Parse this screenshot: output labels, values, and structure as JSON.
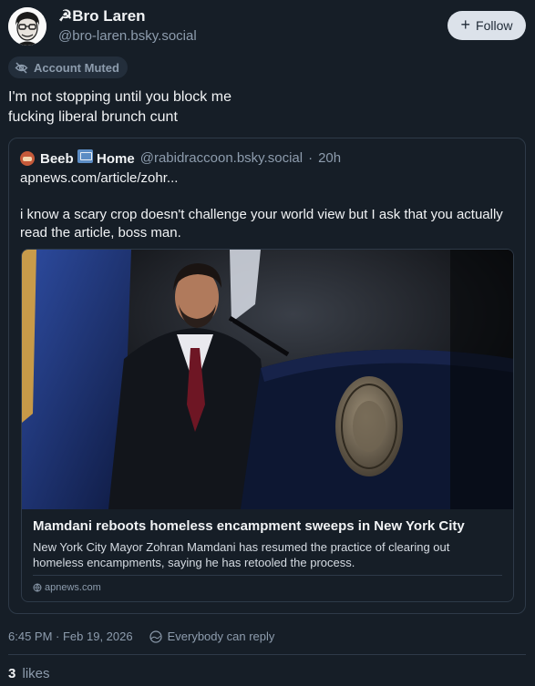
{
  "author": {
    "name": "☭Bro Laren",
    "handle": "@bro-laren.bsky.social"
  },
  "follow_button": {
    "label": "Follow"
  },
  "muted_badge": {
    "label": "Account Muted"
  },
  "post": {
    "line1": "I'm not stopping until you block me",
    "line2": "fucking liberal brunch cunt"
  },
  "quote": {
    "author_name_part1": "Beeb",
    "author_name_part2": "Home",
    "handle": "@rabidraccoon.bsky.social",
    "separator": "·",
    "time": "20h",
    "link_text": "apnews.com/article/zohr...",
    "body": "i know a scary crop doesn't challenge your world view but I ask that you actually read the article, boss man."
  },
  "link_card": {
    "title": "Mamdani reboots homeless encampment sweeps in New York City",
    "description": "New York City Mayor Zohran Mamdani has resumed the practice of clearing out homeless encampments, saying he has retooled the process.",
    "domain": "apnews.com"
  },
  "meta": {
    "timestamp": "6:45 PM · Feb 19, 2026",
    "reply_setting": "Everybody can reply"
  },
  "likes": {
    "count": "3",
    "label": "likes"
  },
  "colors": {
    "background": "#161e27",
    "text": "#f1f3f5",
    "muted_text": "#8d9cad",
    "border": "#2e3a48",
    "follow_bg": "#dce2ea"
  }
}
